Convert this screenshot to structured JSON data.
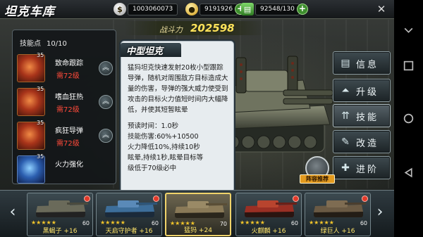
{
  "header": {
    "title": "坦克车库",
    "resources": [
      {
        "icon": "silver-coin-icon",
        "value": "1003060073",
        "color": "#c9c9c9"
      },
      {
        "icon": "gold-coin-icon",
        "value": "9191926",
        "color": "#e0b62b"
      },
      {
        "icon": "garage-capacity-icon",
        "value": "92548/130",
        "color": "#53b845"
      }
    ]
  },
  "power": {
    "label": "战斗力",
    "value": "202598"
  },
  "skills": {
    "points_label": "技能点",
    "points_value": "10/10",
    "items": [
      {
        "level": "35",
        "name": "致命跟踪",
        "need": "需72级",
        "icon": "homing-missile-icon"
      },
      {
        "level": "35",
        "name": "嗜血狂热",
        "need": "需72级",
        "icon": "blood-frenzy-icon"
      },
      {
        "level": "35",
        "name": "疯狂导弹",
        "need": "需72级",
        "icon": "crazy-missile-icon"
      },
      {
        "level": "35",
        "name": "火力强化",
        "need": "",
        "icon": "firepower-boost-icon"
      }
    ]
  },
  "popup": {
    "title": "中型坦克",
    "description": "猛犸坦克快速发射20枚小型跟踪导弹，随机对周围敌方目标造成大量的伤害，导弹的强大威力使受到攻击的目标火力值短时间内大幅降低，并使其短暂眩晕",
    "stats": [
      "预读时间：1.0秒",
      "技能伤害:60%+10500",
      "火力降低10%,持续10秒",
      "眩晕,持续1秒,眩晕目标等",
      "级低于70级必中"
    ]
  },
  "menu": [
    {
      "label": "信息",
      "icon": "info-icon"
    },
    {
      "label": "升级",
      "icon": "upgrade-icon"
    },
    {
      "label": "技能",
      "icon": "skill-icon"
    },
    {
      "label": "改造",
      "icon": "modify-icon"
    },
    {
      "label": "进阶",
      "icon": "advance-icon"
    }
  ],
  "lineup_label": "阵容推荐",
  "tanks": [
    {
      "name": "黑蝎子 +16",
      "level": "60",
      "stars": "★★★★★",
      "color": "#6a6a5a"
    },
    {
      "name": "天启守护者 +16",
      "level": "60",
      "stars": "★★★★★",
      "color": "#3d6e9a"
    },
    {
      "name": "猛犸 +24",
      "level": "70",
      "stars": "★★★★★",
      "color": "#8a7a58",
      "selected": true
    },
    {
      "name": "火麒麟 +16",
      "level": "60",
      "stars": "★★★★★",
      "color": "#9a2f24"
    },
    {
      "name": "绿巨人 +16",
      "level": "60",
      "stars": "★★★★★",
      "color": "#6a5a44"
    }
  ]
}
